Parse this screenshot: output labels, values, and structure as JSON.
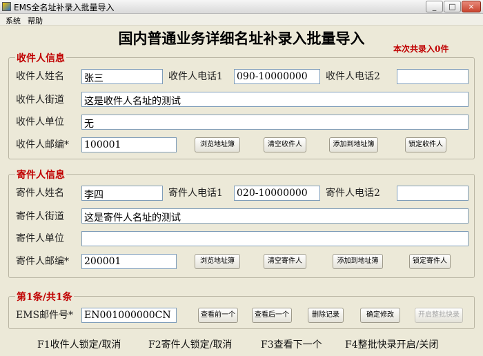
{
  "window": {
    "title": "EMS全名址补录入批量导入",
    "minimize": "_",
    "maximize": "□",
    "close": "×"
  },
  "menu": [
    "系统",
    "帮助"
  ],
  "header": {
    "title": "国内普通业务详细名址补录入批量导入",
    "count_note": "本次共录入0件"
  },
  "recipient": {
    "group_title": "收件人信息",
    "name_label": "收件人姓名",
    "name_value": "张三",
    "phone1_label": "收件人电话1",
    "phone1_value": "090-10000000",
    "phone2_label": "收件人电话2",
    "phone2_value": "",
    "street_label": "收件人街道",
    "street_value": "这是收件人名址的测试",
    "company_label": "收件人单位",
    "company_value": "无",
    "postcode_label": "收件人邮编*",
    "postcode_value": "100001",
    "buttons": {
      "browse": "浏览地址簿",
      "clear": "清空收件人",
      "add": "添加到地址簿",
      "lock": "锁定收件人"
    }
  },
  "sender": {
    "group_title": "寄件人信息",
    "name_label": "寄件人姓名",
    "name_value": "李四",
    "phone1_label": "寄件人电话1",
    "phone1_value": "020-10000000",
    "phone2_label": "寄件人电话2",
    "phone2_value": "",
    "street_label": "寄件人街道",
    "street_value": "这是寄件人名址的测试",
    "company_label": "寄件人单位",
    "company_value": "",
    "postcode_label": "寄件人邮编*",
    "postcode_value": "200001",
    "buttons": {
      "browse": "浏览地址簿",
      "clear": "清空寄件人",
      "add": "添加到地址簿",
      "lock": "锁定寄件人"
    }
  },
  "record": {
    "group_title": "第1条/共1条",
    "ems_label": "EMS邮件号*",
    "ems_value": "EN001000000CN",
    "buttons": {
      "prev": "查看前一个",
      "next": "查看后一个",
      "delete": "删除记录",
      "confirm": "确定修改",
      "batch": "开启整批快录"
    }
  },
  "hotkeys": [
    "F1收件人锁定/取消",
    "F2寄件人锁定/取消",
    "F3查看下一个",
    "F4整批快录开启/关闭"
  ]
}
